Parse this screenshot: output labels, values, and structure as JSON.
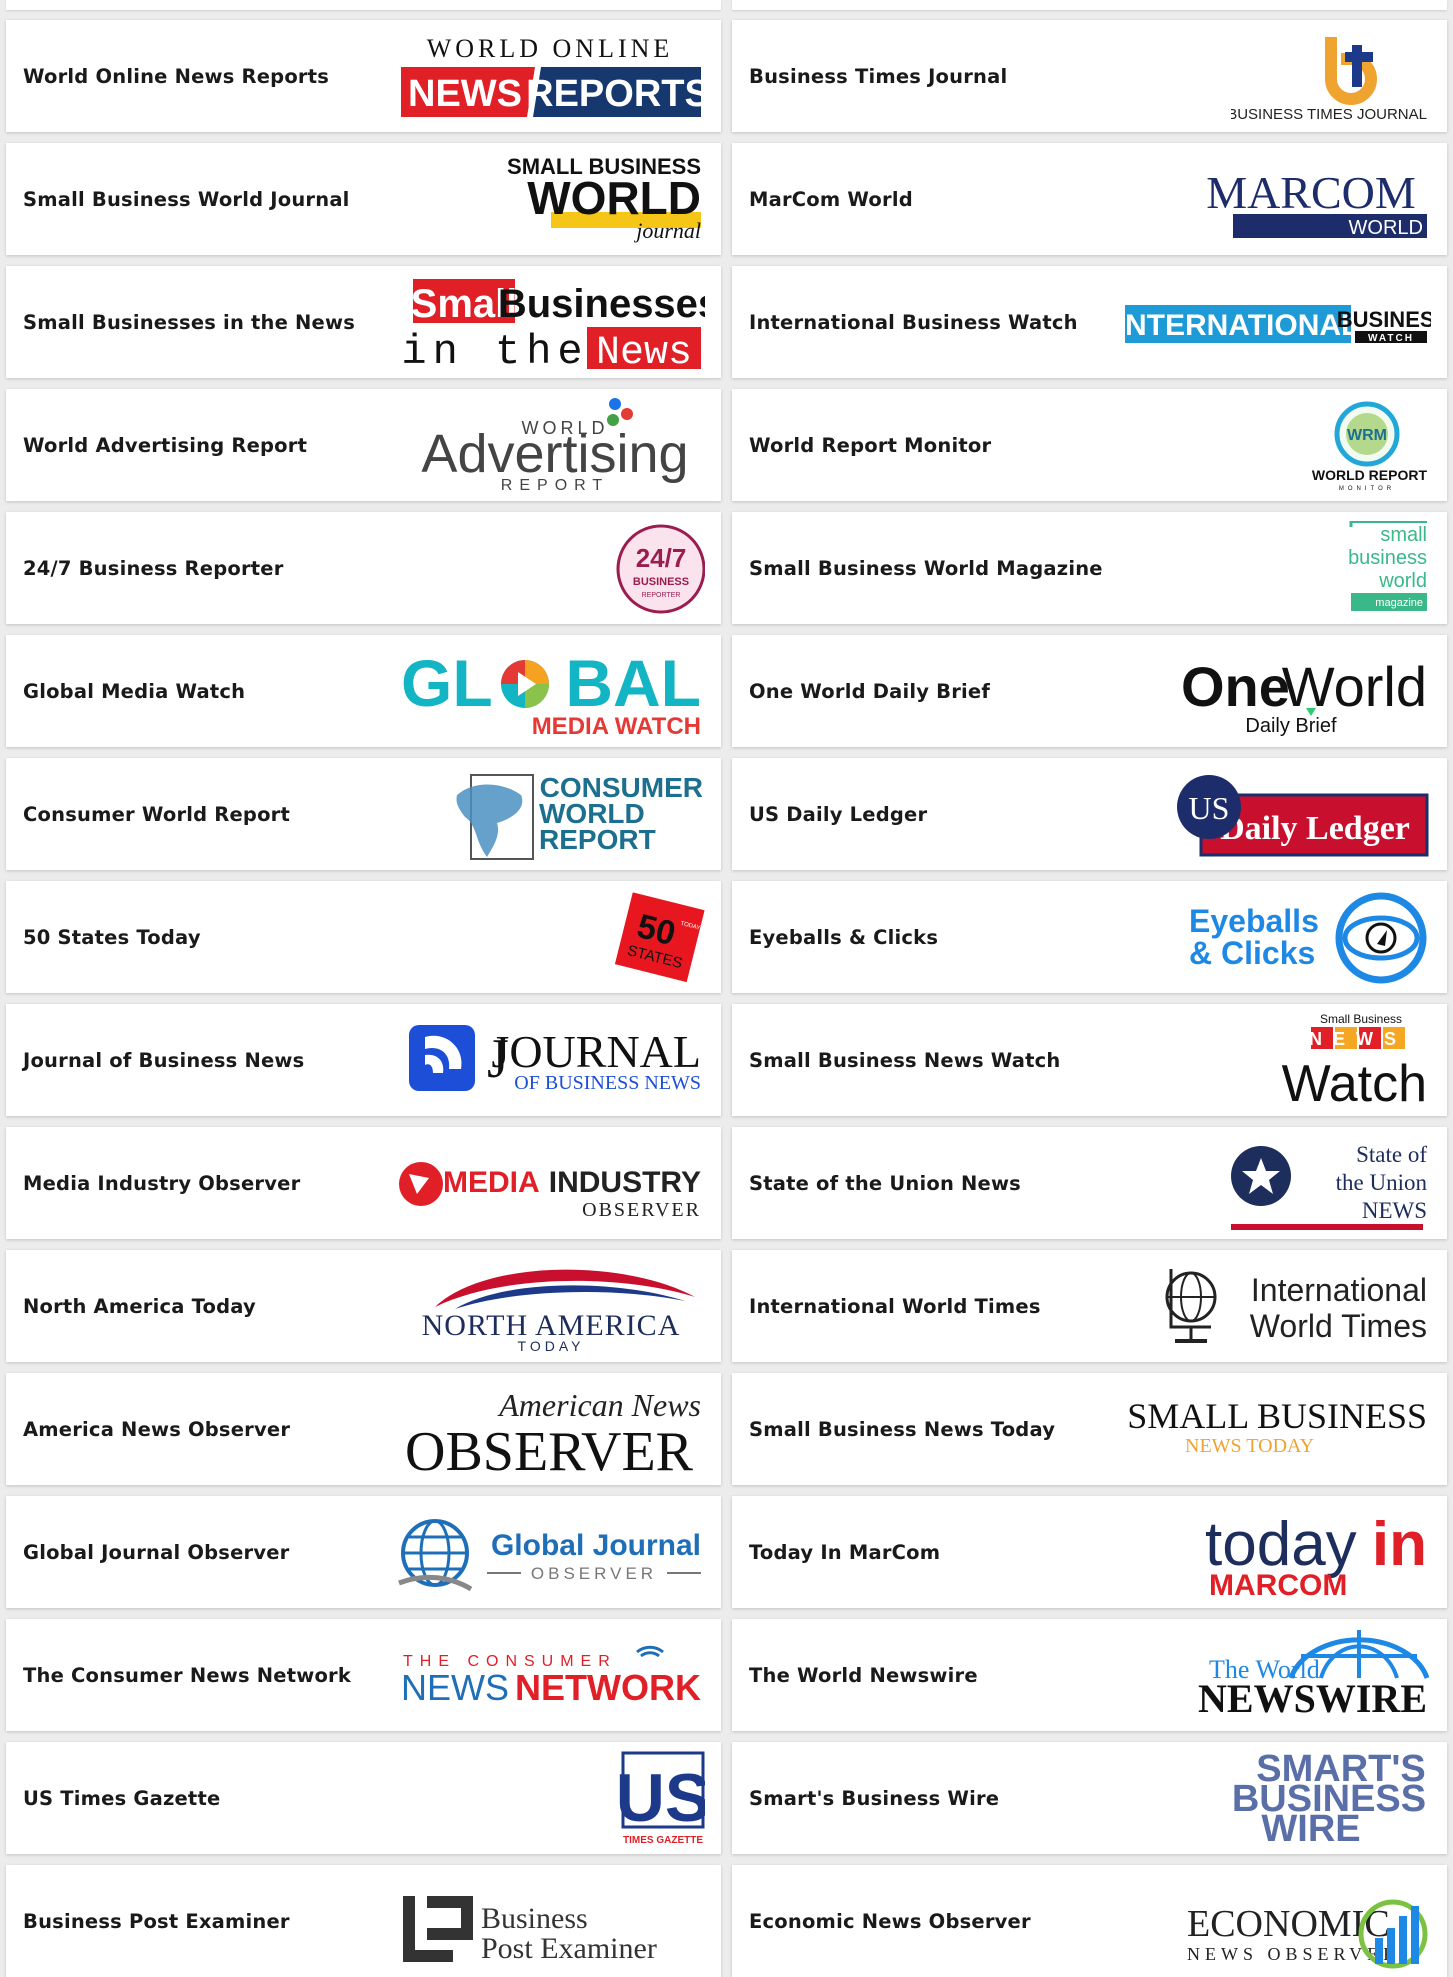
{
  "left_column": [
    {
      "name": "World Online News Reports",
      "logo": {
        "line1": "WORLD ONLINE",
        "line2a": "NEWS",
        "line2b": "REPORTS"
      }
    },
    {
      "name": "Small Business World Journal",
      "logo": {
        "line1": "SMALL BUSINESS",
        "line2": "WORLD",
        "line3": "journal"
      }
    },
    {
      "name": "Small Businesses in the News",
      "logo": {
        "line1a": "Small",
        "line1b": "Businesses",
        "line2a": "in the",
        "line2b": "News"
      }
    },
    {
      "name": "World Advertising Report",
      "logo": {
        "line1": "WORLD",
        "line2": "Advertising",
        "line3": "REPORT"
      }
    },
    {
      "name": "24/7 Business Reporter",
      "logo": {
        "line1": "24/7",
        "line2": "BUSINESS",
        "line3": "REPORTER"
      }
    },
    {
      "name": "Global Media Watch",
      "logo": {
        "line1a": "GL",
        "line1b": "BAL",
        "line2": "MEDIA WATCH"
      }
    },
    {
      "name": "Consumer World Report",
      "logo": {
        "line1": "CONSUMER",
        "line2": "WORLD",
        "line3": "REPORT"
      }
    },
    {
      "name": "50 States Today",
      "logo": {
        "line1": "50",
        "line2": "STATES",
        "line3": "TODAY"
      }
    },
    {
      "name": "Journal of Business News",
      "logo": {
        "line1": "JOURNAL",
        "line2": "OF BUSINESS NEWS"
      }
    },
    {
      "name": "Media Industry Observer",
      "logo": {
        "line1a": "MEDIA",
        "line1b": "INDUSTRY",
        "line2": "OBSERVER"
      }
    },
    {
      "name": "North America Today",
      "logo": {
        "line1": "NORTH AMERICA",
        "line2": "TODAY"
      }
    },
    {
      "name": "America News Observer",
      "logo": {
        "line1": "American News",
        "line2": "OBSERVER"
      }
    },
    {
      "name": "Global Journal Observer",
      "logo": {
        "line1": "Global Journal",
        "line2": "OBSERVER"
      }
    },
    {
      "name": "The Consumer News Network",
      "logo": {
        "line1": "THE CONSUMER",
        "line2a": "NEWS",
        "line2b": "NETWORK"
      }
    },
    {
      "name": "US Times Gazette",
      "logo": {
        "line1": "US",
        "line2": "TIMES GAZETTE"
      }
    },
    {
      "name": "Business Post Examiner",
      "logo": {
        "line1": "Business",
        "line2": "Post Examiner"
      }
    }
  ],
  "right_column": [
    {
      "name": "Business Times Journal",
      "logo": {
        "line1": "BUSINESS TIMES JOURNAL"
      }
    },
    {
      "name": "MarCom World",
      "logo": {
        "line1": "MARCOM",
        "line2": "WORLD"
      }
    },
    {
      "name": "International Business Watch",
      "logo": {
        "line1": "INTERNATIONAL",
        "line2": "BUSINESS",
        "line3": "WATCH"
      }
    },
    {
      "name": "World Report Monitor",
      "logo": {
        "line1": "WRM",
        "line2": "WORLD REPORT",
        "line3": "MONITOR"
      }
    },
    {
      "name": "Small Business World Magazine",
      "logo": {
        "line1": "small",
        "line2": "business",
        "line3": "world",
        "line4": "magazine"
      }
    },
    {
      "name": "One World Daily Brief",
      "logo": {
        "line1a": "One",
        "line1b": "World",
        "line2": "Daily Brief"
      }
    },
    {
      "name": "US Daily Ledger",
      "logo": {
        "line1": "US",
        "line2": "Daily Ledger"
      }
    },
    {
      "name": "Eyeballs & Clicks",
      "logo": {
        "line1": "Eyeballs",
        "line2": "& Clicks"
      }
    },
    {
      "name": "Small Business News Watch",
      "logo": {
        "line1": "Small Business",
        "line2": "NEWS",
        "line3": "Watch"
      }
    },
    {
      "name": "State of the Union News",
      "logo": {
        "line1": "State of",
        "line2": "the Union",
        "line3": "NEWS"
      }
    },
    {
      "name": "International World Times",
      "logo": {
        "line1": "International",
        "line2": "World Times"
      }
    },
    {
      "name": "Small Business News Today",
      "logo": {
        "line1": "SMALL BUSINESS",
        "line2": "NEWS TODAY"
      }
    },
    {
      "name": "Today In MarCom",
      "logo": {
        "line1a": "today",
        "line1b": "in",
        "line2": "MARCOM"
      }
    },
    {
      "name": "The World Newswire",
      "logo": {
        "line1": "The World",
        "line2": "NEWSWIRE"
      }
    },
    {
      "name": "Smart's Business Wire",
      "logo": {
        "line1": "SMART'S",
        "line2": "BUSINESS",
        "line3": "WIRE"
      }
    },
    {
      "name": "Economic News Observer",
      "logo": {
        "line1": "ECONOMIC",
        "line2": "NEWS OBSERVER"
      }
    }
  ]
}
